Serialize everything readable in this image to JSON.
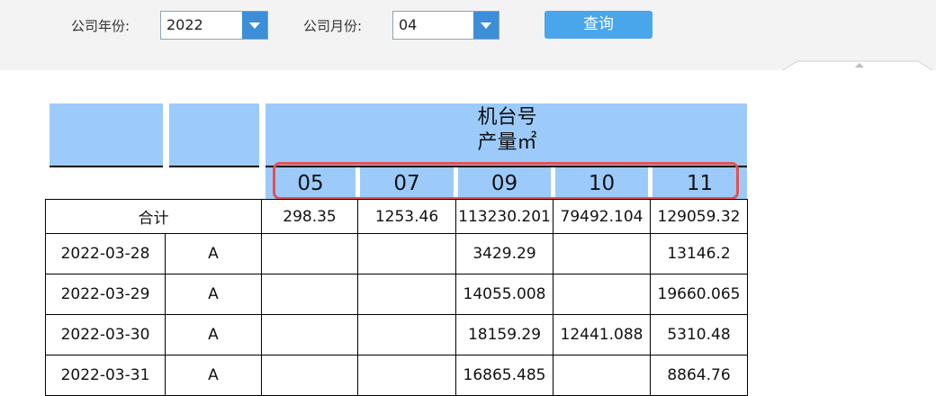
{
  "filters": {
    "year_label": "公司年份:",
    "year_value": "2022",
    "month_label": "公司月份:",
    "month_value": "04",
    "query_label": "查询"
  },
  "report": {
    "header_line1": "机台号",
    "header_line2": "产量㎡",
    "machines": [
      "05",
      "07",
      "09",
      "10",
      "11"
    ],
    "total_label": "合计",
    "totals": [
      "298.35",
      "1253.46",
      "113230.201",
      "79492.104",
      "129059.32"
    ],
    "rows": [
      {
        "date": "2022-03-28",
        "shift": "A",
        "values": [
          "",
          "",
          "3429.29",
          "",
          "13146.2"
        ]
      },
      {
        "date": "2022-03-29",
        "shift": "A",
        "values": [
          "",
          "",
          "14055.008",
          "",
          "19660.065"
        ]
      },
      {
        "date": "2022-03-30",
        "shift": "A",
        "values": [
          "",
          "",
          "18159.29",
          "12441.088",
          "5310.48"
        ]
      },
      {
        "date": "2022-03-31",
        "shift": "A",
        "values": [
          "",
          "",
          "16865.485",
          "",
          "8864.76"
        ]
      }
    ]
  },
  "colors": {
    "header_blue": "#9ccbfb",
    "button_blue": "#4aa6ea",
    "highlight_red": "#e25252"
  }
}
